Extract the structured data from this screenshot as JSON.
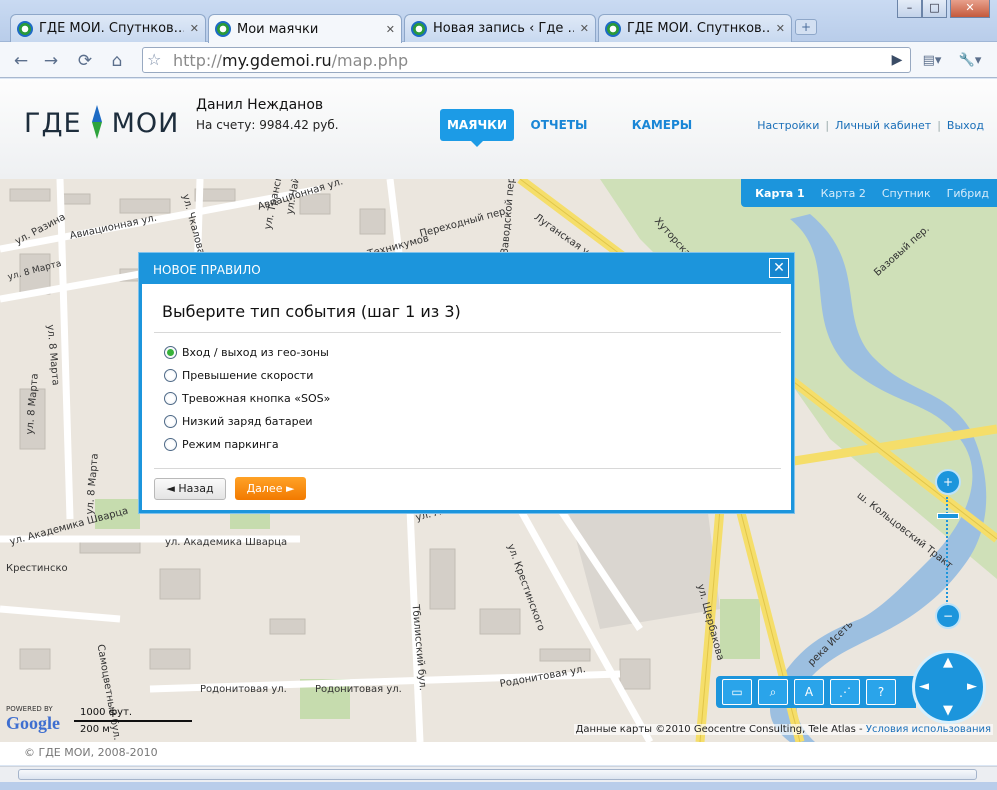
{
  "browser": {
    "tabs": [
      {
        "title": "ГДЕ МОИ. Спутнков…",
        "active": false
      },
      {
        "title": "Мои маячки",
        "active": true
      },
      {
        "title": "Новая запись ‹ Где …",
        "active": false
      },
      {
        "title": "ГДЕ МОИ. Спутнков…",
        "active": false
      }
    ],
    "new_tab_label": "+",
    "url_scheme": "http://",
    "url_host": "my.gdemoi.ru",
    "url_path": "/map.php",
    "window_buttons": {
      "minimize": "–",
      "maximize": "□",
      "close": "✕"
    },
    "icons": {
      "back": "←",
      "forward": "→",
      "reload": "⟳",
      "home": "⌂",
      "bookmark": "☆",
      "go": "▶",
      "page": "▤▾",
      "wrench": "🔧▾"
    }
  },
  "header": {
    "logo_left": "ГДЕ",
    "logo_right": "МОИ",
    "user_name": "Данил Нежданов",
    "balance": "На счету: 9984.42 руб.",
    "nav": [
      "МАЯЧКИ",
      "ОТЧЕТЫ",
      "КАМЕРЫ"
    ],
    "active_nav": "МАЯЧКИ",
    "links": [
      "Настройки",
      "Личный кабинет",
      "Выход"
    ],
    "link_separator": "|",
    "accent_color": "#1c9be6"
  },
  "map": {
    "map_types": [
      "Карта 1",
      "Карта 2",
      "Спутник",
      "Гибрид"
    ],
    "active_map_type": "Карта 1",
    "streets": [
      "ул. Разина",
      "Авиационная ул.",
      "ул. Чкалова",
      "Авиационная ул.",
      "ул. Чайковского",
      "ул. Транспортная",
      "ул. Техникумов",
      "Переходный пер.",
      "Заводской пер.",
      "Луганская ул.",
      "Хуторская ул.",
      "Базовый пер.",
      "ул. 8 Марта",
      "ул. 8 Марта",
      "ул. 8 Марта",
      "ул. 8 Марта",
      "ул. Академика Шварца",
      "ул. Академика Шварца",
      "Крестинско",
      "ул. Крестинского",
      "Тбилисский бул.",
      "ул. Щербакова",
      "ш. Кольцовский Тракт",
      "река Исеть",
      "Самоцветный бул.",
      "Родонитовая ул.",
      "Родонитовая ул.",
      "Родонитовая ул.",
      "ул. Ак"
    ],
    "powered_by": "POWERED BY",
    "google": "Google",
    "scale_ft": "1000 фут.",
    "scale_m": "200 м",
    "copyright_text": "Данные карты ©2010 Geocentre Consulting, Tele Atlas - ",
    "copyright_link": "Условия использования",
    "zoom_in": "+",
    "zoom_out": "−",
    "tools": [
      "▭",
      "⌕",
      "A",
      "⋰",
      "?"
    ]
  },
  "modal": {
    "header": "НОВОЕ ПРАВИЛО",
    "close_label": "✕",
    "title": "Выберите тип события (шаг 1 из 3)",
    "options": [
      "Вход / выход из гео-зоны",
      "Превышение скорости",
      "Тревожная кнопка «SOS»",
      "Низкий заряд батареи",
      "Режим паркинга"
    ],
    "selected_option": "Вход / выход из гео-зоны",
    "back_label": "◄ Назад",
    "next_label": "Далее ►"
  },
  "footer": {
    "copyright": "© ГДЕ МОИ, 2008-2010"
  }
}
